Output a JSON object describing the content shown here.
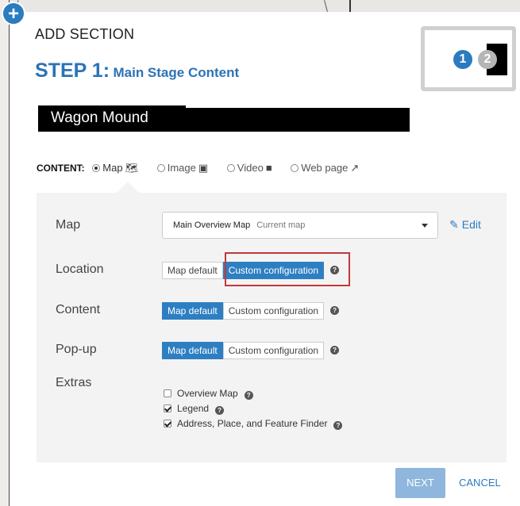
{
  "header": {
    "title": "ADD SECTION",
    "step_number": "STEP 1:",
    "step_name": "Main Stage Content"
  },
  "steps": {
    "one": "1",
    "two": "2"
  },
  "section_title": {
    "value": "Wagon Mound"
  },
  "content_type": {
    "label": "CONTENT:",
    "options": [
      {
        "label": "Map",
        "icon": "map-icon",
        "selected": true
      },
      {
        "label": "Image",
        "icon": "camera-icon",
        "selected": false
      },
      {
        "label": "Video",
        "icon": "video-icon",
        "selected": false
      },
      {
        "label": "Web page",
        "icon": "external-link-icon",
        "selected": false
      }
    ]
  },
  "map_row": {
    "label": "Map",
    "selected_map": "Main Overview Map",
    "current_note": "Current map",
    "edit_label": "Edit"
  },
  "location_row": {
    "label": "Location",
    "option_default": "Map default",
    "option_custom": "Custom configuration",
    "active": "custom"
  },
  "content_row": {
    "label": "Content",
    "option_default": "Map default",
    "option_custom": "Custom configuration",
    "active": "default"
  },
  "popup_row": {
    "label": "Pop-up",
    "option_default": "Map default",
    "option_custom": "Custom configuration",
    "active": "default"
  },
  "extras": {
    "label": "Extras",
    "items": [
      {
        "label": "Overview Map",
        "checked": false
      },
      {
        "label": "Legend",
        "checked": true
      },
      {
        "label": "Address, Place, and Feature Finder",
        "checked": true
      }
    ]
  },
  "footer": {
    "next_label": "NEXT",
    "cancel_label": "CANCEL"
  },
  "colors": {
    "accent": "#2b7bc0",
    "highlight": "#c0393b",
    "panel": "#f3f3f3"
  }
}
